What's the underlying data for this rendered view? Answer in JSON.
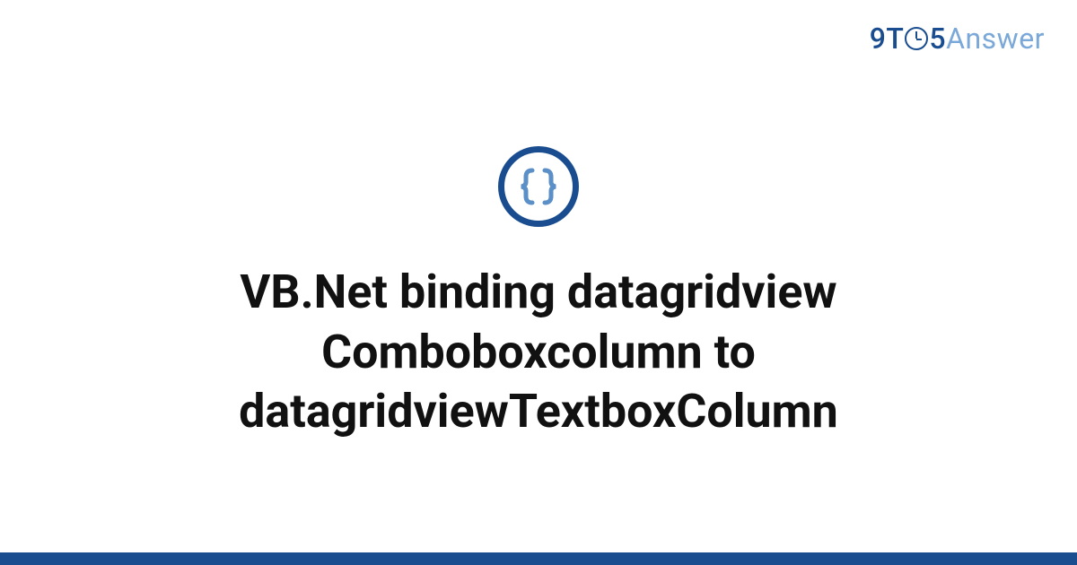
{
  "logo": {
    "part1": "9T",
    "part2": "5",
    "part3": "Answer"
  },
  "icon": {
    "name": "curly-braces-icon"
  },
  "title": "VB.Net binding datagridview Comboboxcolumn to datagridviewTextboxColumn",
  "colors": {
    "accent": "#1a4d8f",
    "accent_light": "#5a8fc7"
  }
}
